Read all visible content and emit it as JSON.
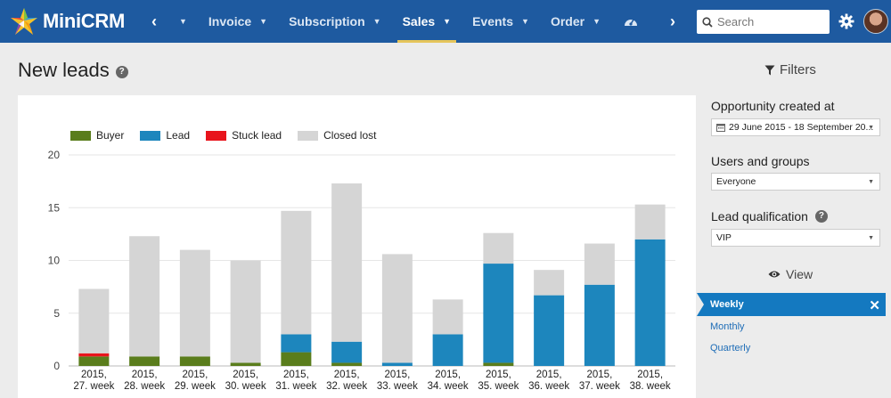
{
  "app": {
    "name": "MiniCRM"
  },
  "nav": {
    "prev": "‹",
    "next": "›",
    "items": [
      {
        "label": "Invoice",
        "active": false
      },
      {
        "label": "Subscription",
        "active": false
      },
      {
        "label": "Sales",
        "active": true
      },
      {
        "label": "Events",
        "active": false
      },
      {
        "label": "Order",
        "active": false
      }
    ],
    "dashboard_icon": "speedometer-icon"
  },
  "search": {
    "placeholder": "Search"
  },
  "page": {
    "title": "New leads"
  },
  "filters": {
    "heading": "Filters",
    "opportunity_label": "Opportunity created at",
    "opportunity_value": "29 June 2015 - 18 September 20...",
    "users_label": "Users and groups",
    "users_value": "Everyone",
    "qualification_label": "Lead qualification",
    "qualification_value": "VIP"
  },
  "view": {
    "heading": "View",
    "active": "Weekly",
    "options": [
      "Monthly",
      "Quarterly"
    ]
  },
  "colors": {
    "buyer": "#5a7d1c",
    "lead": "#1d86bd",
    "stuck": "#e8141c",
    "closed": "#d5d5d5",
    "accent": "#1e5aa0"
  },
  "chart_data": {
    "type": "bar",
    "stacked": true,
    "legend_position": "top-left",
    "grid": true,
    "ylim": [
      0,
      20
    ],
    "yticks": [
      0,
      5,
      10,
      15,
      20
    ],
    "categories": [
      [
        "2015,",
        "27. week"
      ],
      [
        "2015,",
        "28. week"
      ],
      [
        "2015,",
        "29. week"
      ],
      [
        "2015,",
        "30. week"
      ],
      [
        "2015,",
        "31. week"
      ],
      [
        "2015,",
        "32. week"
      ],
      [
        "2015,",
        "33. week"
      ],
      [
        "2015,",
        "34. week"
      ],
      [
        "2015,",
        "35. week"
      ],
      [
        "2015,",
        "36. week"
      ],
      [
        "2015,",
        "37. week"
      ],
      [
        "2015,",
        "38. week"
      ]
    ],
    "series": [
      {
        "name": "Buyer",
        "color": "#5a7d1c",
        "values": [
          0.9,
          0.9,
          0.9,
          0.3,
          1.3,
          0.3,
          0,
          0,
          0.3,
          0,
          0,
          0
        ]
      },
      {
        "name": "Lead",
        "color": "#1d86bd",
        "values": [
          0,
          0,
          0,
          0,
          1.7,
          2.0,
          0.3,
          3.0,
          9.4,
          6.7,
          7.7,
          12.0
        ]
      },
      {
        "name": "Stuck lead",
        "color": "#e8141c",
        "values": [
          0.3,
          0,
          0,
          0,
          0,
          0,
          0,
          0,
          0,
          0,
          0,
          0
        ]
      },
      {
        "name": "Closed lost",
        "color": "#d5d5d5",
        "values": [
          6.1,
          11.4,
          10.1,
          9.7,
          11.7,
          15.0,
          10.3,
          3.3,
          2.9,
          2.4,
          3.9,
          3.3
        ]
      }
    ]
  }
}
